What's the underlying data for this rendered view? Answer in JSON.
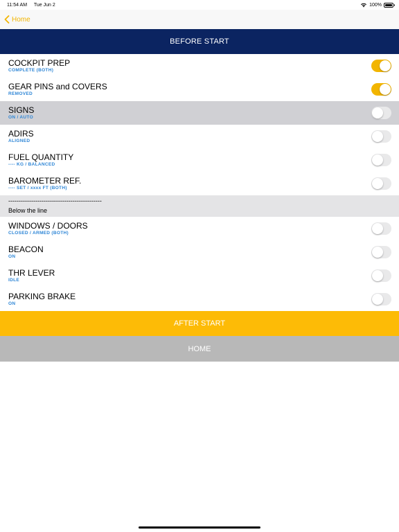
{
  "status": {
    "time": "11:54 AM",
    "date": "Tue Jun 2",
    "battery": "100%"
  },
  "nav": {
    "back_label": "Home"
  },
  "title": "BEFORE START",
  "items_top": [
    {
      "title": "COCKPIT PREP",
      "sub": "COMPLETE (BOTH)",
      "on": true,
      "highlight": false
    },
    {
      "title": "GEAR PINS and COVERS",
      "sub": "REMOVED",
      "on": true,
      "highlight": false
    },
    {
      "title": "SIGNS",
      "sub": "ON / AUTO",
      "on": false,
      "highlight": true
    },
    {
      "title": "ADIRS",
      "sub": "ALIGNED",
      "on": false,
      "highlight": false
    },
    {
      "title": "FUEL QUANTITY",
      "sub": "---- KG / BALANCED",
      "on": false,
      "highlight": false
    },
    {
      "title": "BAROMETER REF.",
      "sub": "---- SET / xxxx FT (BOTH)",
      "on": false,
      "highlight": false
    }
  ],
  "separator": {
    "dashes": "---------------------------------------------",
    "label": "Below the line"
  },
  "items_bottom": [
    {
      "title": "WINDOWS / DOORS",
      "sub": "CLOSED / ARMED (BOTH)",
      "on": false,
      "highlight": false
    },
    {
      "title": "BEACON",
      "sub": "ON",
      "on": false,
      "highlight": false
    },
    {
      "title": "THR LEVER",
      "sub": "IDLE",
      "on": false,
      "highlight": false
    },
    {
      "title": "PARKING BRAKE",
      "sub": "ON",
      "on": false,
      "highlight": false
    }
  ],
  "buttons": {
    "after_start": "AFTER START",
    "home": "HOME"
  },
  "colors": {
    "accent": "#f2b500",
    "title_bar": "#0b2461",
    "after_start": "#fdbb06",
    "home": "#b8b8b8",
    "subtitle": "#2e86d6"
  }
}
